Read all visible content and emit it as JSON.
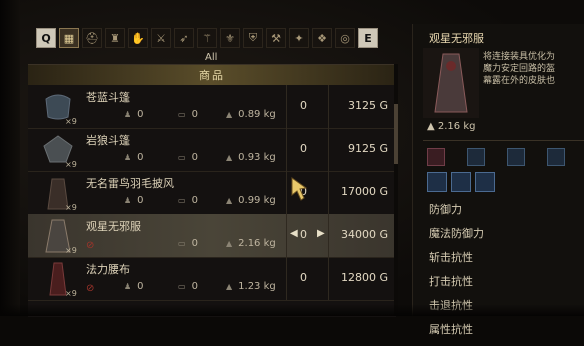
{
  "tabs": {
    "left_key": "Q",
    "right_key": "E",
    "icons": [
      "grid-icon",
      "helmet-icon",
      "chest-armor-icon",
      "gauntlet-icon",
      "leg-armor-icon",
      "bow-icon",
      "staff-icon",
      "seal-icon",
      "shield-icon",
      "tool-icon",
      "talisman-icon",
      "cookbook-icon"
    ]
  },
  "filter_label": "All",
  "list_header": "商品",
  "items": [
    {
      "name": "苍蓝斗篷",
      "qty": "×9",
      "stat_a": "0",
      "stat_b": "0",
      "weight": "0.89 kg",
      "count": "0",
      "price": "3125 G",
      "selected": false,
      "unavailable": false
    },
    {
      "name": "岩狼斗篷",
      "qty": "×9",
      "stat_a": "0",
      "stat_b": "0",
      "weight": "0.93 kg",
      "count": "0",
      "price": "9125 G",
      "selected": false,
      "unavailable": false
    },
    {
      "name": "无名雷鸟羽毛披风",
      "qty": "×9",
      "stat_a": "0",
      "stat_b": "0",
      "weight": "0.99 kg",
      "count": "0",
      "price": "17000 G",
      "selected": false,
      "unavailable": false
    },
    {
      "name": "观星无邪服",
      "qty": "×9",
      "stat_a": "",
      "stat_b": "0",
      "weight": "2.16 kg",
      "count": "0",
      "price": "34000 G",
      "selected": true,
      "unavailable": true
    },
    {
      "name": "法力腰布",
      "qty": "×9",
      "stat_a": "0",
      "stat_b": "0",
      "weight": "1.23 kg",
      "count": "0",
      "price": "12800 G",
      "selected": false,
      "unavailable": false
    }
  ],
  "detail": {
    "title": "观星无邪服",
    "desc_lines": [
      "将连接装具优化为",
      "魔力安定回路的盔",
      "幕露在外的皮肤也"
    ],
    "weight": "2.16 kg",
    "stats": [
      "防御力",
      "魔法防御力",
      "斩击抗性",
      "打击抗性",
      "击退抗性",
      "属性抗性"
    ]
  }
}
